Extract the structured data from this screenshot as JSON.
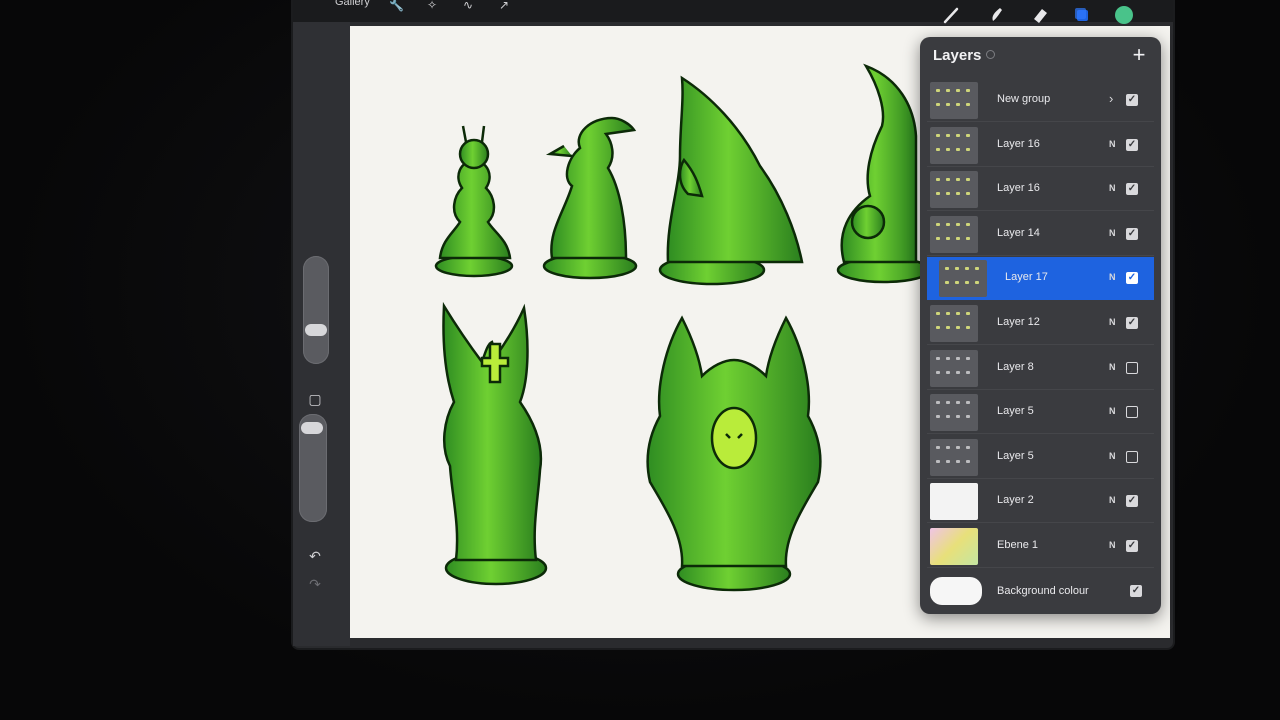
{
  "topbar": {
    "gallery_label": "Gallery",
    "left_tools": [
      "wrench-icon",
      "magic-wand-icon",
      "selection-icon",
      "transform-icon"
    ],
    "right_tools": [
      "brush-icon",
      "smudge-icon",
      "eraser-icon",
      "layers-icon",
      "color-swatch"
    ],
    "active_color": "#49c38a",
    "layers_accent": "#1e63e0"
  },
  "sidebar": {
    "undo_icon": "undo-icon",
    "redo_icon": "redo-icon",
    "modify_button_icon": "square-icon"
  },
  "layers_panel": {
    "title": "Layers",
    "add_icon": "plus-icon",
    "layers": [
      {
        "name": "New group",
        "mode": "",
        "is_group": true,
        "visible": true,
        "selected": false
      },
      {
        "name": "Layer 16",
        "mode": "N",
        "is_group": false,
        "visible": true,
        "selected": false
      },
      {
        "name": "Layer 16",
        "mode": "N",
        "is_group": false,
        "visible": true,
        "selected": false
      },
      {
        "name": "Layer 14",
        "mode": "N",
        "is_group": false,
        "visible": true,
        "selected": false
      },
      {
        "name": "Layer 17",
        "mode": "N",
        "is_group": false,
        "visible": true,
        "selected": true
      },
      {
        "name": "Layer 12",
        "mode": "N",
        "is_group": false,
        "visible": true,
        "selected": false
      },
      {
        "name": "Layer 8",
        "mode": "N",
        "is_group": false,
        "visible": false,
        "selected": false
      },
      {
        "name": "Layer 5",
        "mode": "N",
        "is_group": false,
        "visible": false,
        "selected": false
      },
      {
        "name": "Layer 5",
        "mode": "N",
        "is_group": false,
        "visible": false,
        "selected": false
      },
      {
        "name": "Layer 2",
        "mode": "N",
        "is_group": false,
        "visible": true,
        "selected": false
      },
      {
        "name": "Ebene 1",
        "mode": "N",
        "is_group": false,
        "visible": true,
        "selected": false
      }
    ],
    "background": {
      "label": "Background colour",
      "visible": true,
      "color": "#f6f6f6"
    }
  },
  "canvas": {
    "background_color": "#f4f3ef",
    "art_primary": "#4fbf2f",
    "art_highlight": "#b9ec3a",
    "art_shadow": "#1f6f1a",
    "art_outline": "#0c2a08"
  }
}
